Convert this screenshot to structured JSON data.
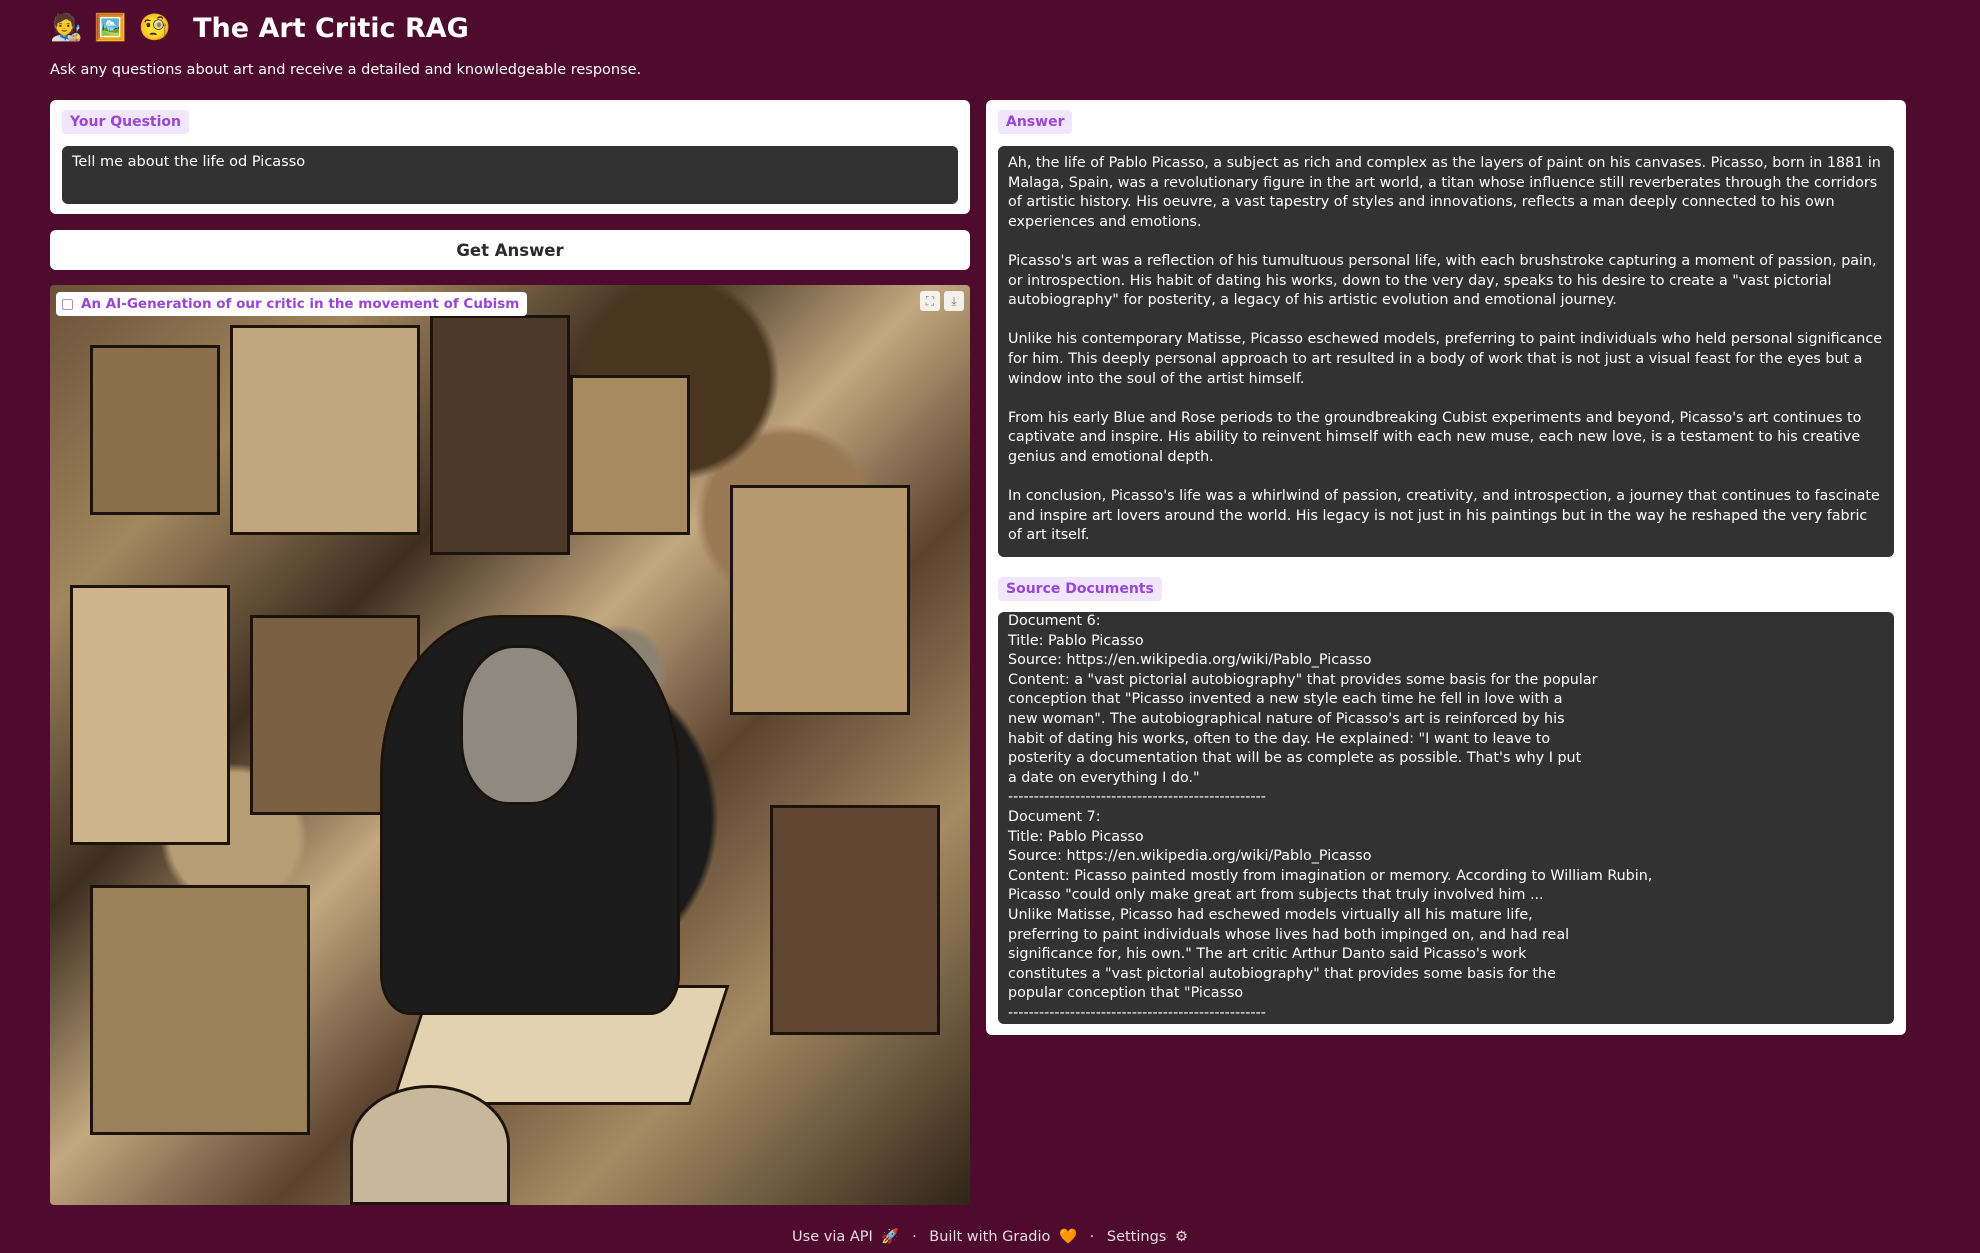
{
  "header": {
    "emoji_1": "🧑‍🎨",
    "emoji_2": "🖼️",
    "emoji_3": "🧐",
    "title": "The Art Critic RAG",
    "subtitle": "Ask any questions about art and receive a detailed and knowledgeable response."
  },
  "question": {
    "label": "Your Question",
    "value": "Tell me about the life od Picasso"
  },
  "button": {
    "label": "Get Answer"
  },
  "image": {
    "label": "An AI-Generation of our critic in the movement of Cubism",
    "fullscreen_icon": "⛶",
    "download_icon": "⤓"
  },
  "answer": {
    "label": "Answer",
    "paragraphs": [
      "Ah, the life of Pablo Picasso, a subject as rich and complex as the layers of paint on his canvases. Picasso, born in 1881 in Malaga, Spain, was a revolutionary figure in the art world, a titan whose influence still reverberates through the corridors of artistic history. His oeuvre, a vast tapestry of styles and innovations, reflects a man deeply connected to his own experiences and emotions.",
      "Picasso's art was a reflection of his tumultuous personal life, with each brushstroke capturing a moment of passion, pain, or introspection. His habit of dating his works, down to the very day, speaks to his desire to create a \"vast pictorial autobiography\" for posterity, a legacy of his artistic evolution and emotional journey.",
      "Unlike his contemporary Matisse, Picasso eschewed models, preferring to paint individuals who held personal significance for him. This deeply personal approach to art resulted in a body of work that is not just a visual feast for the eyes but a window into the soul of the artist himself.",
      "From his early Blue and Rose periods to the groundbreaking Cubist experiments and beyond, Picasso's art continues to captivate and inspire. His ability to reinvent himself with each new muse, each new love, is a testament to his creative genius and emotional depth.",
      "In conclusion, Picasso's life was a whirlwind of passion, creativity, and introspection, a journey that continues to fascinate and inspire art lovers around the world. His legacy is not just in his paintings but in the way he reshaped the very fabric of art itself."
    ]
  },
  "sources": {
    "label": "Source Documents",
    "text": "Document 6:\nTitle: Pablo Picasso\nSource: https://en.wikipedia.org/wiki/Pablo_Picasso\nContent: a \"vast pictorial autobiography\" that provides some basis for the popular\nconception that \"Picasso invented a new style each time he fell in love with a\nnew woman\". The autobiographical nature of Picasso's art is reinforced by his\nhabit of dating his works, often to the day. He explained: \"I want to leave to\nposterity a documentation that will be as complete as possible. That's why I put\na date on everything I do.\"\n--------------------------------------------------\nDocument 7:\nTitle: Pablo Picasso\nSource: https://en.wikipedia.org/wiki/Pablo_Picasso\nContent: Picasso painted mostly from imagination or memory. According to William Rubin,\nPicasso \"could only make great art from subjects that truly involved him ...\nUnlike Matisse, Picasso had eschewed models virtually all his mature life,\npreferring to paint individuals whose lives had both impinged on, and had real\nsignificance for, his own.\" The art critic Arthur Danto said Picasso's work\nconstitutes a \"vast pictorial autobiography\" that provides some basis for the\npopular conception that \"Picasso\n--------------------------------------------------"
  },
  "footer": {
    "api_label": "Use via API",
    "api_icon": "🚀",
    "built_label": "Built with Gradio",
    "built_icon": "🧡",
    "settings_label": "Settings",
    "settings_icon": "⚙",
    "separator": "·"
  }
}
